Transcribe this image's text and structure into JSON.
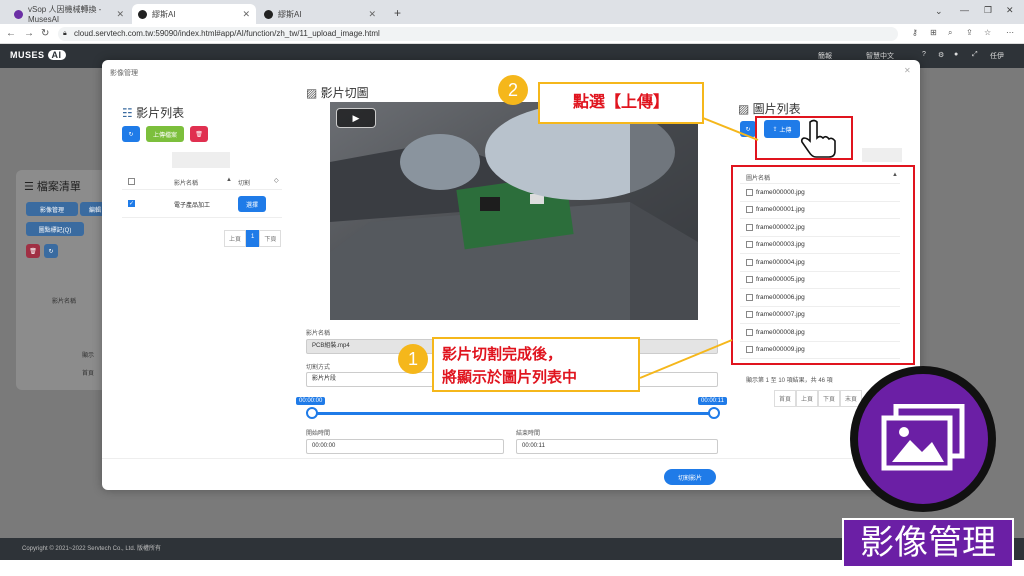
{
  "browser": {
    "tabs": [
      {
        "title": "vSop 人因機械轉換 - MusesAI",
        "active": false
      },
      {
        "title": "繆斯AI",
        "active": true
      },
      {
        "title": "繆斯AI",
        "active": false
      }
    ],
    "new_tab": "+",
    "url": "cloud.servtech.com.tw:59090/index.html#app/AI/function/zh_tw/11_upload_image.html"
  },
  "app": {
    "logo": "MUSES",
    "logo_ai": "AI",
    "header_items": [
      "簡報",
      "智慧中文",
      "任伊"
    ]
  },
  "background": {
    "title": "檔案清單",
    "btn_image_mgmt": "影像管理",
    "btn_other": "編輯",
    "btn_tag": "圖點標記(Q)",
    "col_header": "影片名稱",
    "info": "顯示",
    "pager": "首頁"
  },
  "modal": {
    "title": "影像管理",
    "video_list": {
      "title": "影片列表",
      "upload": "上傳檔案",
      "col_name": "影片名稱",
      "col_cut": "切割",
      "rows": [
        {
          "name": "電子產品加工",
          "action": "選擇",
          "checked": true
        }
      ],
      "prev": "上頁",
      "page": "1",
      "next": "下頁"
    },
    "cutting": {
      "title": "影片切圖",
      "name_label": "影片名稱",
      "name_value": "PCB組裝.mp4",
      "method_label": "切割方式",
      "method_value": "影片片段",
      "slider_start": "00:00:00",
      "slider_end": "00:00:11",
      "start_label": "開始時間",
      "start_value": "00:00:00",
      "end_label": "結束時間",
      "end_value": "00:00:11",
      "cut_button": "切割影片"
    },
    "image_list": {
      "title": "圖片列表",
      "upload": "上傳",
      "col_name": "圖片名稱",
      "files": [
        "frame000000.jpg",
        "frame000001.jpg",
        "frame000002.jpg",
        "frame000003.jpg",
        "frame000004.jpg",
        "frame000005.jpg",
        "frame000006.jpg",
        "frame000007.jpg",
        "frame000008.jpg",
        "frame000009.jpg"
      ],
      "info": "顯示第 1 至 10 項結果，共 46 項",
      "pager": [
        "首頁",
        "上頁",
        "下頁",
        "末頁"
      ]
    }
  },
  "annotations": {
    "step1_num": "1",
    "step1_line1": "影片切割完成後，",
    "step1_line2": "將顯示於圖片列表中",
    "step2_num": "2",
    "step2_text": "點選【上傳】",
    "badge_label": "影像管理"
  },
  "footer": "Copyright © 2021~2022 Servtech Co., Ltd. 版權所有",
  "colors": {
    "accent": "#1f7be8",
    "callout": "#f5b71b",
    "highlight": "#e0141e",
    "badge": "#6b1fa5"
  }
}
